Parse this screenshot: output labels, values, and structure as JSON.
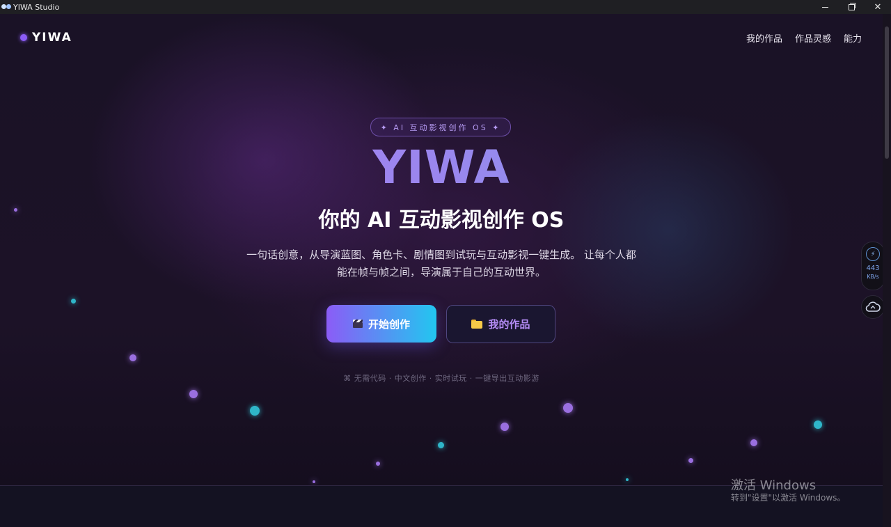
{
  "window": {
    "title": "YIWA Studio",
    "controls": {
      "minimize": "—",
      "maximize": "□",
      "close": "✕"
    }
  },
  "nav": {
    "logo": "YIWA",
    "links": [
      "我的作品",
      "作品灵感",
      "能力"
    ]
  },
  "hero": {
    "tag": "✦ AI 互动影视创作 OS ✦",
    "brand": "YIWA",
    "headline": "你的 AI 互动影视创作 OS",
    "description_line1": "一句话创意，从导演蓝图、角色卡、剧情图到试玩与互动影视一键生成。 让每个人都",
    "description_line2": "能在帧与帧之间，导演属于自己的互动世界。",
    "primary_button": "开始创作",
    "secondary_button": "我的作品",
    "features_icon": "⌘",
    "features": "无需代码 · 中文创作 · 实时试玩 · 一键导出互动影游"
  },
  "speed_widget": {
    "value": "443",
    "unit": "KB/s"
  },
  "watermark": {
    "title": "激活 Windows",
    "subtitle": "转到\"设置\"以激活 Windows。"
  },
  "colors": {
    "accent_purple": "#8b5cf6",
    "accent_cyan": "#22c6f0",
    "background": "#1a1226"
  },
  "icons": {
    "primary_button": "clapperboard-icon",
    "secondary_button": "folder-icon",
    "speed": "speed-gauge-icon",
    "cloud": "cloud-sync-icon"
  }
}
